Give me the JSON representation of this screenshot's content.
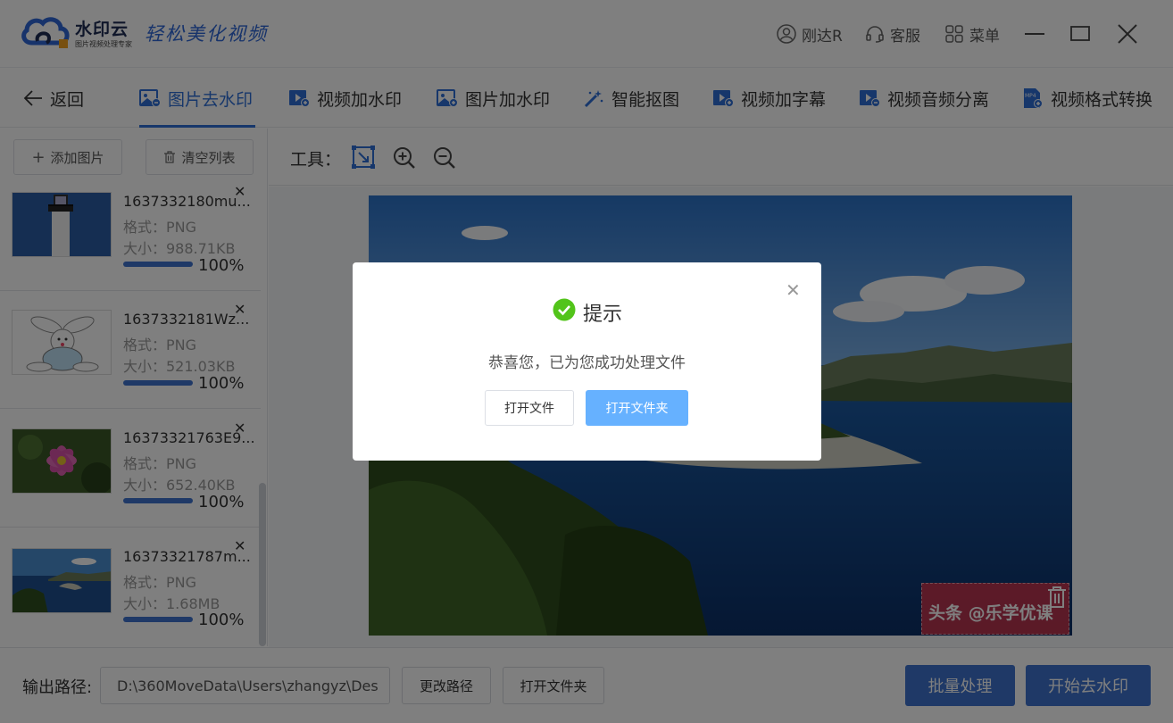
{
  "app": {
    "brand_name": "水印云",
    "brand_sub": "图片视频处理专家",
    "slogan": "轻松美化视频"
  },
  "titlebar": {
    "user": "刚达R",
    "service": "客服",
    "menu": "菜单"
  },
  "nav": {
    "back": "返回",
    "tabs": [
      {
        "label": "图片去水印",
        "icon": "image-icon",
        "active": true
      },
      {
        "label": "视频加水印",
        "icon": "video-icon"
      },
      {
        "label": "图片加水印",
        "icon": "image-icon"
      },
      {
        "label": "智能抠图",
        "icon": "magic-wand-icon"
      },
      {
        "label": "视频加字幕",
        "icon": "video-icon"
      },
      {
        "label": "视频音频分离",
        "icon": "video-icon"
      },
      {
        "label": "视频格式转换",
        "icon": "mp4-file-icon"
      }
    ]
  },
  "sidebar": {
    "add_label": "添加图片",
    "clear_label": "清空列表",
    "items": [
      {
        "name": "1637332180mu...",
        "format": "格式：PNG",
        "size": "大小：988.71KB",
        "progress": "100%",
        "progress_value": 1.0,
        "thumb": "lighthouse"
      },
      {
        "name": "1637332181Wz...",
        "format": "格式：PNG",
        "size": "大小：521.03KB",
        "progress": "100%",
        "progress_value": 1.0,
        "thumb": "bunny"
      },
      {
        "name": "16373321763E9...",
        "format": "格式：PNG",
        "size": "大小：652.40KB",
        "progress": "100%",
        "progress_value": 1.0,
        "thumb": "flower"
      },
      {
        "name": "16373321787m...",
        "format": "格式：PNG",
        "size": "大小：1.68MB",
        "progress": "100%",
        "progress_value": 1.0,
        "thumb": "coast"
      }
    ]
  },
  "tools": {
    "label": "工具："
  },
  "canvas": {
    "watermark_text": "头条 @乐学优课"
  },
  "bottom": {
    "output_label": "输出路径:",
    "output_path": "D:\\360MoveData\\Users\\zhangyz\\Des",
    "change_path": "更改路径",
    "open_folder": "打开文件夹",
    "batch": "批量处理",
    "start": "开始去水印"
  },
  "dialog": {
    "title": "提示",
    "message": "恭喜您，已为您成功处理文件",
    "open_file": "打开文件",
    "open_folder": "打开文件夹"
  },
  "colors": {
    "primary": "#3e73cf",
    "accent": "#2e6fd6",
    "dialog_button": "#66b1ff",
    "success": "#52c41a"
  }
}
